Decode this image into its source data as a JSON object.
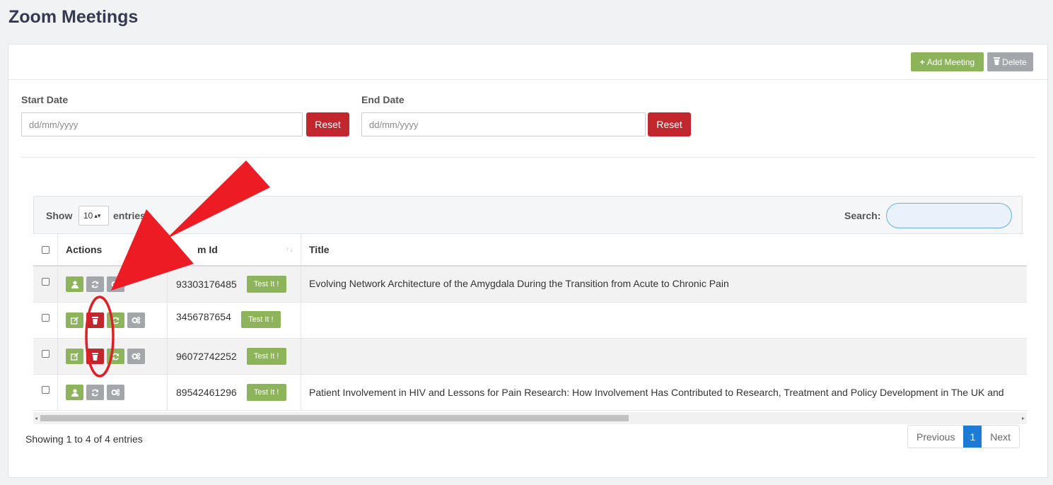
{
  "page": {
    "title": "Zoom Meetings"
  },
  "header": {
    "add_label": "Add Meeting",
    "add_icon": "plus-icon",
    "delete_label": "Delete",
    "delete_icon": "trash-icon"
  },
  "filters": {
    "start_label": "Start Date",
    "start_placeholder": "dd/mm/yyyy",
    "end_label": "End Date",
    "end_placeholder": "dd/mm/yyyy",
    "reset_label": "Reset"
  },
  "table": {
    "show_label": "Show",
    "entries_label": "entries",
    "length_value": "10",
    "search_label": "Search:",
    "columns": [
      "Actions",
      "m Id",
      "Title"
    ],
    "sort_icon": "↑↓",
    "test_label": "Test It !",
    "rows": [
      {
        "id": "93303176485",
        "title": "Evolving Network Architecture of the Amygdala During the Transition from Acute to Chronic Pain",
        "actions": [
          "user-icon",
          "refresh-icon",
          "cogs-icon"
        ]
      },
      {
        "id": "3456787654",
        "title": "",
        "actions": [
          "edit-icon",
          "trash-icon",
          "refresh-icon",
          "cogs-icon"
        ]
      },
      {
        "id": "96072742252",
        "title": "",
        "actions": [
          "edit-icon",
          "trash-icon",
          "refresh-icon",
          "cogs-icon"
        ]
      },
      {
        "id": "89542461296",
        "title": "Patient Involvement in HIV and Lessons for Pain Research: How Involvement Has Contributed to Research, Treatment and Policy Development in The UK and",
        "actions": [
          "user-icon",
          "refresh-icon",
          "cogs-icon"
        ]
      }
    ]
  },
  "footer": {
    "info": "Showing 1 to 4 of 4 entries",
    "previous": "Previous",
    "page": "1",
    "next": "Next"
  },
  "colors": {
    "accent_green": "#8db45a",
    "danger_red": "#c1272d",
    "annotation_red": "#ed1c24",
    "primary_blue": "#1c7cd5"
  }
}
